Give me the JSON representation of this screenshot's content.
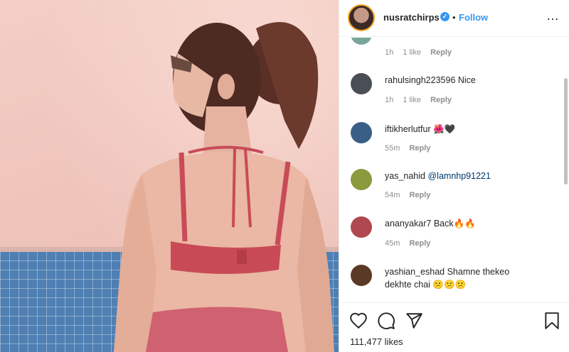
{
  "post": {
    "username": "nusratchirps",
    "verified_mark": "✓",
    "separator": "•",
    "follow_label": "Follow",
    "more_icon": "…",
    "likes": "111,477 likes"
  },
  "comments": [
    {
      "username": "",
      "text": "",
      "time": "1h",
      "likes": "1 like",
      "reply": "Reply",
      "avatar_color": "#7aa59a"
    },
    {
      "username": "rahulsingh223596",
      "text": "Nice",
      "time": "1h",
      "likes": "1 like",
      "reply": "Reply",
      "avatar_color": "#4a4f55"
    },
    {
      "username": "iftikherlutfur",
      "text": "🌺🖤",
      "time": "55m",
      "likes": "",
      "reply": "Reply",
      "avatar_color": "#3a5f85"
    },
    {
      "username": "yas_nahid",
      "text": "@lamnhp91221",
      "time": "54m",
      "likes": "",
      "reply": "Reply",
      "avatar_color": "#8a9a3c"
    },
    {
      "username": "ananyakar7",
      "text": "Back🔥🔥",
      "time": "45m",
      "likes": "",
      "reply": "Reply",
      "avatar_color": "#b0484f"
    },
    {
      "username": "yashian_eshad",
      "text": "Shamne thekeo",
      "text2": "dekhte chai 😕😕😕",
      "avatar_color": "#5a3a26"
    }
  ],
  "icons": {
    "heart": "heart-icon",
    "comment": "comment-icon",
    "share": "share-icon",
    "bookmark": "bookmark-icon"
  }
}
